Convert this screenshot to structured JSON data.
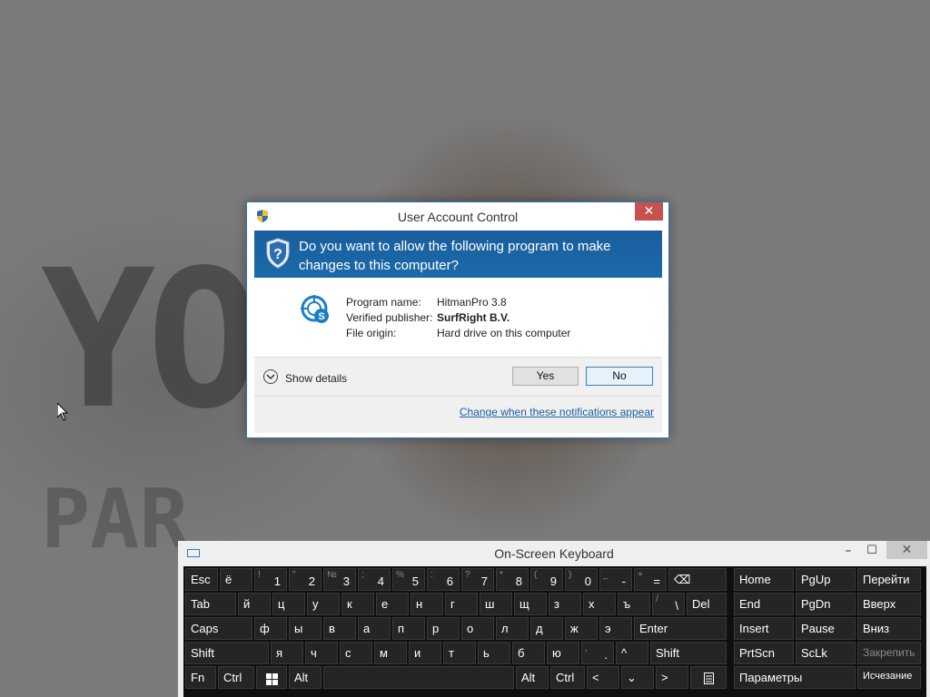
{
  "uac": {
    "title": "User Account Control",
    "close": "✕",
    "question": "Do you want to allow the following program to make changes to this computer?",
    "labels": {
      "program_name": "Program name:",
      "verified_publisher": "Verified publisher:",
      "file_origin": "File origin:"
    },
    "values": {
      "program_name": "HitmanPro 3.8",
      "verified_publisher": "SurfRight B.V.",
      "file_origin": "Hard drive on this computer"
    },
    "show_details": "Show details",
    "yes": "Yes",
    "no": "No",
    "change_link": "Change when these notifications appear"
  },
  "osk": {
    "title": "On-Screen Keyboard",
    "minimize": "–",
    "maximize": "☐",
    "close": "✕",
    "keys": {
      "esc": "Esc",
      "yo": "ё",
      "n1": "1",
      "s1": "!",
      "n2": "2",
      "s2": "\"",
      "n3": "3",
      "s3": "№",
      "n4": "4",
      "s4": ";",
      "n5": "5",
      "s5": "%",
      "n6": "6",
      "s6": ":",
      "n7": "7",
      "s7": "?",
      "n8": "8",
      "s8": "*",
      "n9": "9",
      "s9": "(",
      "n0": "0",
      "s0": ")",
      "minus": "-",
      "sminus": "_",
      "equals": "=",
      "sequals": "+",
      "backspace": "⌫",
      "tab": "Tab",
      "y": "й",
      "ts": "ц",
      "u": "у",
      "k": "к",
      "e": "е",
      "n": "н",
      "g": "г",
      "sh": "ш",
      "shch": "щ",
      "z": "з",
      "kh": "х",
      "hard": "ъ",
      "backslash": "\\",
      "sbackslash": "/",
      "del": "Del",
      "caps": "Caps",
      "f": "ф",
      "yy": "ы",
      "v": "в",
      "a": "а",
      "p": "п",
      "r": "р",
      "o": "о",
      "l": "л",
      "d": "д",
      "zh": "ж",
      "ee": "э",
      "enter": "Enter",
      "shift_left": "Shift",
      "ya": "я",
      "ch": "ч",
      "s": "с",
      "m": "м",
      "i": "и",
      "t": "т",
      "soft": "ь",
      "b": "б",
      "yu": "ю",
      "period": ".",
      "speriod": ",",
      "up": "^",
      "shift_right": "Shift",
      "fn": "Fn",
      "ctrl_left": "Ctrl",
      "alt_left": "Alt",
      "alt_right": "Alt",
      "ctrl_right": "Ctrl",
      "left": "<",
      "down": "⌄",
      "right": ">",
      "home": "Home",
      "pgup": "PgUp",
      "navigate": "Перейти",
      "end": "End",
      "pgdn": "PgDn",
      "upward": "Вверх",
      "insert": "Insert",
      "pause": "Pause",
      "downward": "Вниз",
      "prtscn": "PrtScn",
      "sclk": "ScLk",
      "dock": "Закрепить",
      "options": "Параметры",
      "fade": "Исчезание"
    }
  },
  "background": {
    "text_large": "YOU",
    "text_small": "PAR"
  },
  "colors": {
    "uac_accent": "#1a5e9e",
    "close_red": "#c75050",
    "link": "#1b5fa6",
    "key_bg": "#252525"
  }
}
